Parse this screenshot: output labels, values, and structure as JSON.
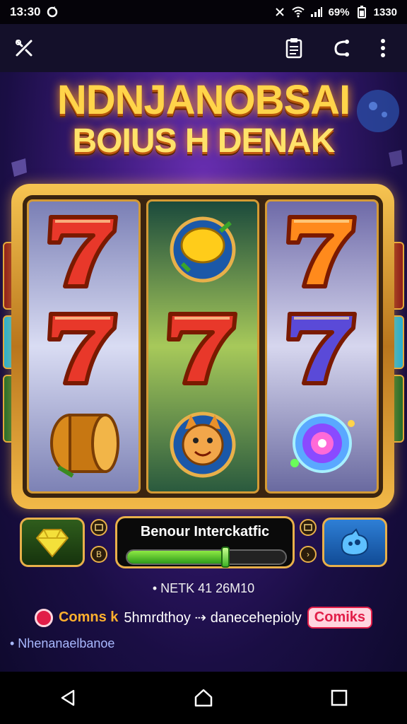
{
  "status_bar": {
    "time": "13:30",
    "battery": "69%",
    "clock_right": "1330"
  },
  "game": {
    "title_line1": "NDNJANOBSAI",
    "title_line2": "BOIUS H DENAK",
    "panel_title": "Benour Interckatfic",
    "progress": 0.62,
    "mini_left_label": "B",
    "mini_right_label": "›"
  },
  "reels": [
    [
      {
        "symbol": "seven",
        "color": "#e8382a"
      },
      {
        "symbol": "seven",
        "color": "#e8382a"
      },
      {
        "symbol": "drum"
      }
    ],
    [
      {
        "symbol": "lemon"
      },
      {
        "symbol": "seven",
        "color": "#e8382a"
      },
      {
        "symbol": "fox"
      }
    ],
    [
      {
        "symbol": "seven",
        "color": "#ff8a1c"
      },
      {
        "symbol": "seven",
        "color": "#5a4ad8"
      },
      {
        "symbol": "swirl"
      }
    ]
  ],
  "info": {
    "line1": "• NETK 41 26M10",
    "label_a": "Comns k",
    "label_b": "5hmrdthoy ⇢ danecehepioly",
    "pill": "Comiks",
    "line3": "• Nhenanaelbanoe"
  },
  "accent_colors": {
    "gold": "#e8b04a",
    "green": "#3fb326",
    "blue": "#2e7fd6",
    "red": "#e11d48"
  }
}
